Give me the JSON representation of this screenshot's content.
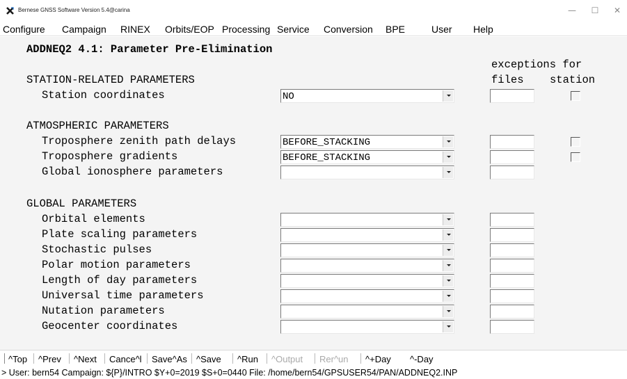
{
  "window": {
    "title": "Bernese GNSS Software Version 5.4@carina",
    "icon": "x-logo-icon",
    "controls": [
      "—",
      "☐",
      "✕"
    ]
  },
  "menu": [
    "Configure",
    "Campaign",
    "RINEX",
    "Orbits/EOP",
    "Processing",
    "Service",
    "Conversion",
    "BPE",
    "User",
    "Help"
  ],
  "panel": {
    "title": "ADDNEQ2 4.1: Parameter Pre-Elimination",
    "exceptions_header": "exceptions for",
    "files_header": "files",
    "station_header": "station",
    "sections": [
      {
        "heading": "STATION-RELATED PARAMETERS",
        "rows": [
          {
            "label": "Station coordinates",
            "value": "NO",
            "station_checkbox": true
          }
        ]
      },
      {
        "heading": "ATMOSPHERIC PARAMETERS",
        "rows": [
          {
            "label": "Troposphere zenith path delays",
            "value": "BEFORE_STACKING",
            "station_checkbox": true
          },
          {
            "label": "Troposphere gradients",
            "value": "BEFORE_STACKING",
            "station_checkbox": true
          },
          {
            "label": "Global ionosphere parameters",
            "value": "",
            "station_checkbox": false
          }
        ]
      },
      {
        "heading": "GLOBAL PARAMETERS",
        "rows": [
          {
            "label": "Orbital elements",
            "value": ""
          },
          {
            "label": "Plate scaling parameters",
            "value": ""
          },
          {
            "label": "Stochastic pulses",
            "value": ""
          },
          {
            "label": "Polar motion parameters",
            "value": ""
          },
          {
            "label": "Length of day parameters",
            "value": ""
          },
          {
            "label": "Universal time parameters",
            "value": ""
          },
          {
            "label": "Nutation parameters",
            "value": ""
          },
          {
            "label": "Geocenter coordinates",
            "value": ""
          }
        ]
      }
    ]
  },
  "buttons": [
    {
      "label": "^Top",
      "enabled": true
    },
    {
      "label": "^Prev",
      "enabled": true
    },
    {
      "label": "^Next",
      "enabled": true
    },
    {
      "label": "Cance^l",
      "enabled": true
    },
    {
      "label": "Save^As",
      "enabled": true
    },
    {
      "label": "^Save",
      "enabled": true
    },
    {
      "label": "^Run",
      "enabled": true
    },
    {
      "label": "^Output",
      "enabled": false
    },
    {
      "label": "Rer^un",
      "enabled": false
    },
    {
      "label": "^+Day",
      "enabled": true
    },
    {
      "label": "^-Day",
      "enabled": true
    }
  ],
  "status": "> User: bern54  Campaign: ${P}/INTRO  $Y+0=2019  $S+0=0440  File: /home/bern54/GPSUSER54/PAN/ADDNEQ2.INP"
}
